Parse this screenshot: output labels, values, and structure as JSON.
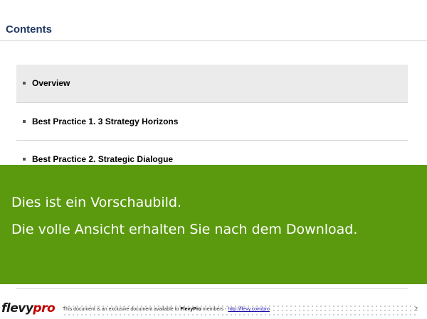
{
  "header": {
    "title": "Contents"
  },
  "toc": {
    "items": [
      {
        "label": "Overview",
        "active": true
      },
      {
        "label": "Best Practice 1.  3 Strategy Horizons",
        "active": false
      },
      {
        "label": "Best Practice 2.  Strategic Dialogue",
        "active": false
      }
    ]
  },
  "preview_banner": {
    "line1": "Dies ist ein Vorschaubild.",
    "line2": "Die volle Ansicht erhalten Sie nach dem Download.",
    "color": "#5b9a0f"
  },
  "footer": {
    "logo_flevy": "flevy",
    "logo_pro": "pro",
    "text_before": "This document is an exclusive document available to ",
    "brand": "FlevyPro",
    "text_after": " members - ",
    "link": "http://flevy.com/pro",
    "page_number": "2"
  }
}
